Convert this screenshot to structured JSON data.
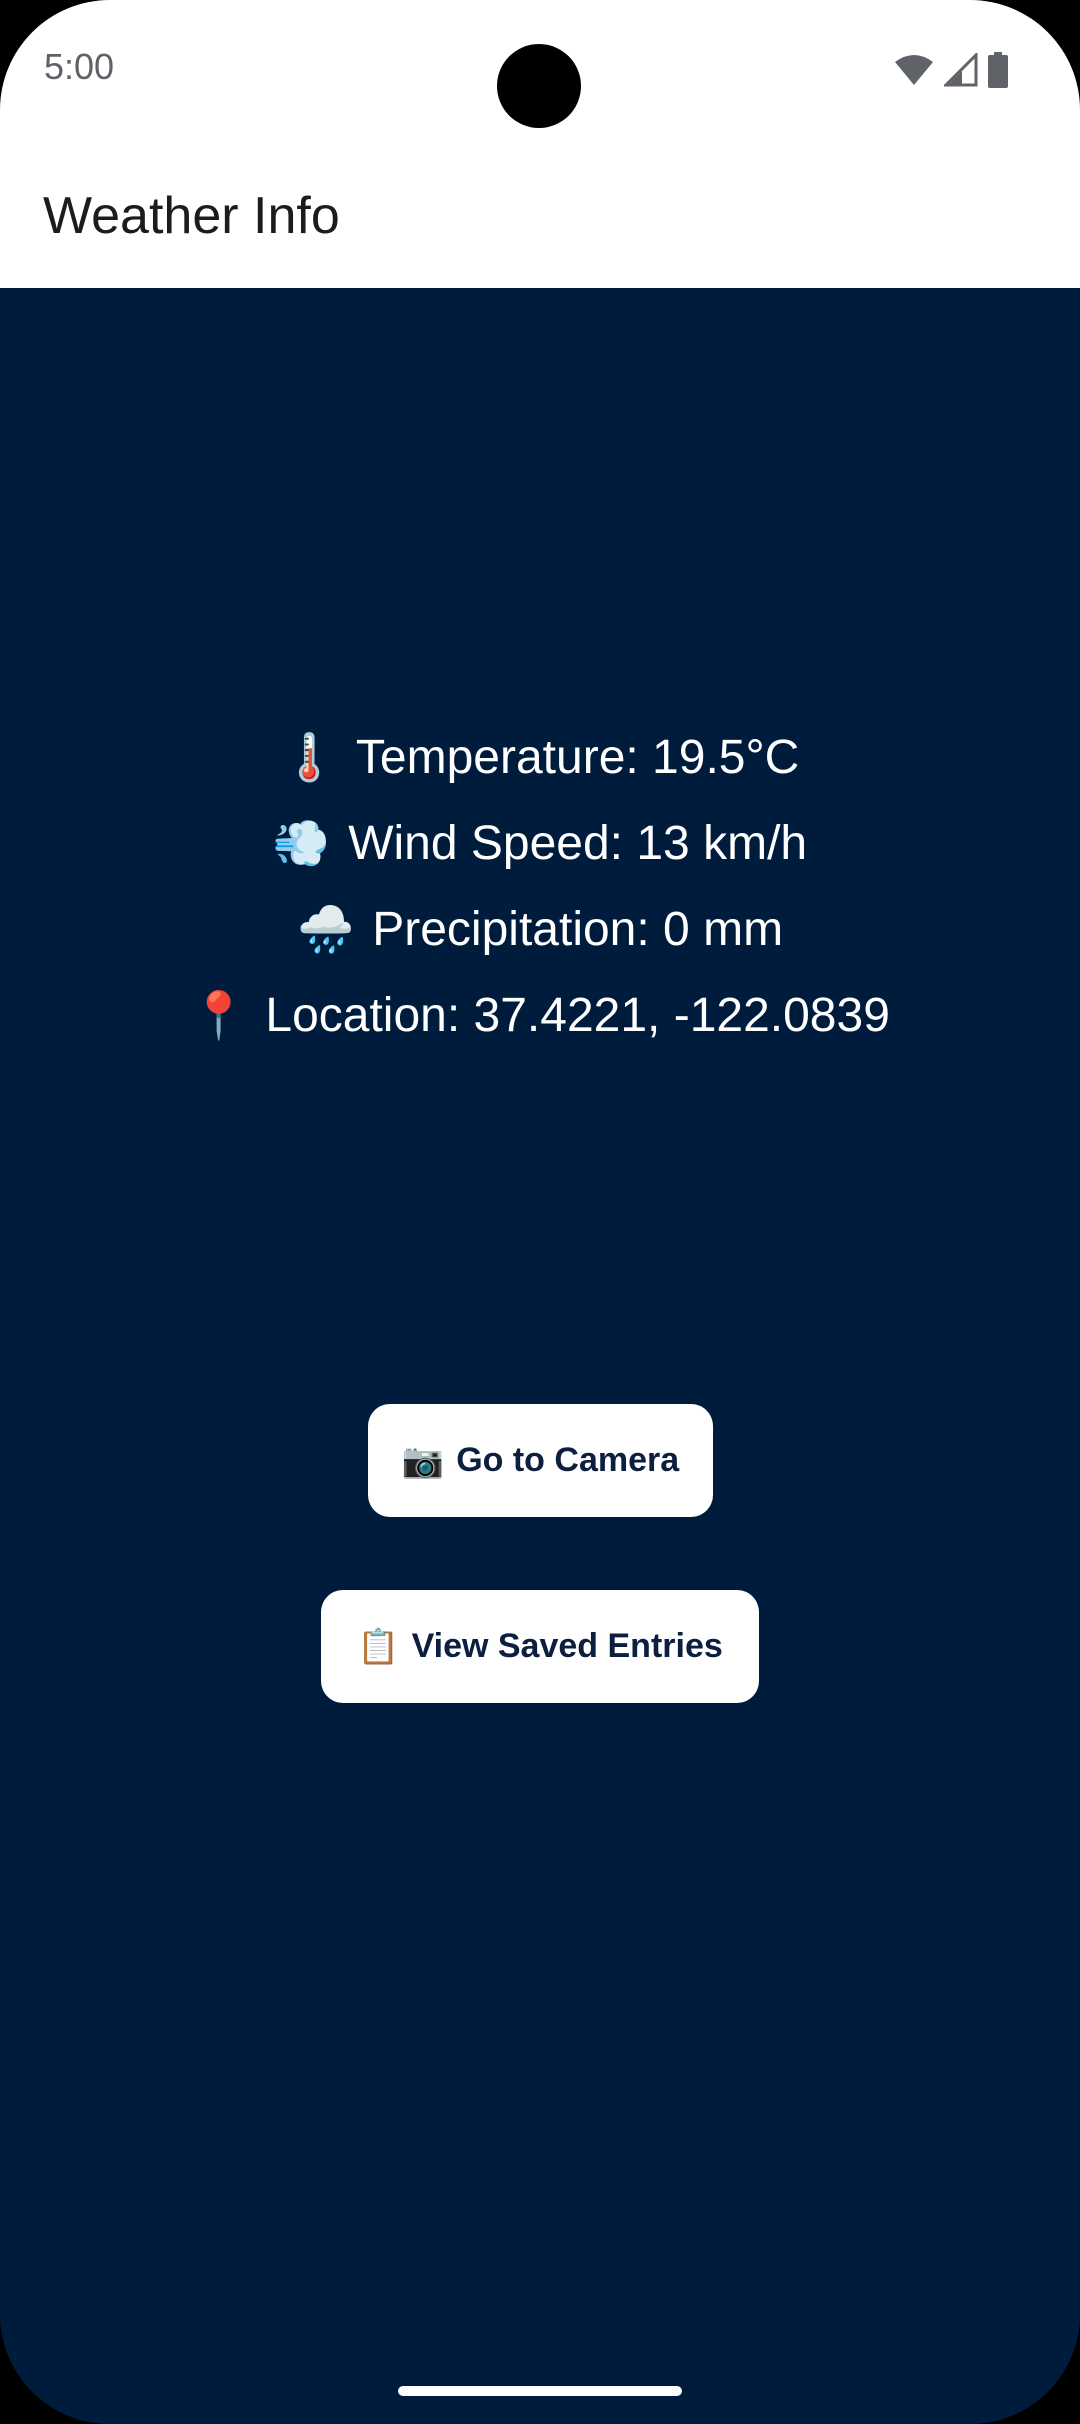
{
  "status_bar": {
    "time": "5:00",
    "icons": [
      "wifi-icon",
      "cellular-signal-icon",
      "battery-icon"
    ]
  },
  "app_bar": {
    "title": "Weather Info"
  },
  "weather": {
    "temperature": {
      "icon": "🌡️",
      "text": "Temperature: 19.5°C"
    },
    "wind_speed": {
      "icon": "💨",
      "text": "Wind Speed: 13 km/h"
    },
    "precipitation": {
      "icon": "🌧️",
      "text": "Precipitation: 0 mm"
    },
    "location": {
      "icon": "📍",
      "text": "Location: 37.4221, -122.0839"
    }
  },
  "buttons": {
    "camera": {
      "icon": "📷",
      "label": "Go to Camera"
    },
    "saved_entries": {
      "icon": "📋",
      "label": "View Saved Entries"
    }
  },
  "colors": {
    "background": "#001c3d",
    "app_bar": "#ffffff",
    "button_bg": "#ffffff",
    "button_text": "#0d1f3f",
    "info_text": "#ffffff"
  }
}
